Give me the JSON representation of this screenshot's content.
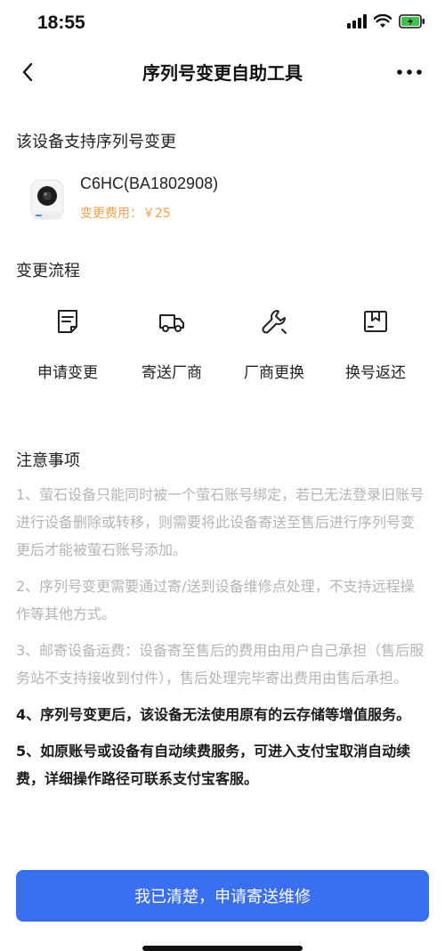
{
  "status_bar": {
    "time": "18:55"
  },
  "nav": {
    "title": "序列号变更自助工具"
  },
  "support": {
    "heading": "该设备支持序列号变更"
  },
  "device": {
    "name": "C6HC(BA1802908)",
    "fee": "变更费用：￥25"
  },
  "process": {
    "heading": "变更流程",
    "steps": [
      {
        "label": "申请变更",
        "icon": "document-icon"
      },
      {
        "label": "寄送厂商",
        "icon": "truck-icon"
      },
      {
        "label": "厂商更换",
        "icon": "wrench-icon"
      },
      {
        "label": "换号返还",
        "icon": "box-icon"
      }
    ]
  },
  "notes": {
    "heading": "注意事项",
    "items": [
      "1、萤石设备只能同时被一个萤石账号绑定，若已无法登录旧账号进行设备删除或转移，则需要将此设备寄送至售后进行序列号变更后才能被萤石账号添加。",
      "2、序列号变更需要通过寄/送到设备维修点处理，不支持远程操作等其他方式。",
      "3、邮寄设备运费：设备寄至售后的费用由用户自己承担（售后服务站不支持接收到付件），售后处理完毕寄出费用由售后承担。",
      "4、序列号变更后，该设备无法使用原有的云存储等增值服务。",
      "5、如原账号或设备有自动续费服务，可进入支付宝取消自动续费，详细操作路径可联系支付宝客服。"
    ]
  },
  "actions": {
    "primary_label": "我已清楚，申请寄送维修"
  },
  "colors": {
    "accent": "#3a6ff0",
    "fee": "#f0a24a",
    "muted_text": "#b4b4b4",
    "battery": "#3cc24a"
  }
}
